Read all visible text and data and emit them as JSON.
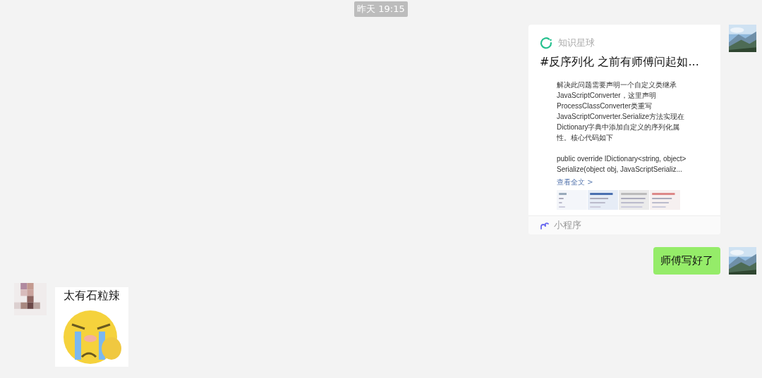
{
  "timestamp": "昨天 19:15",
  "messages": [
    {
      "kind": "card",
      "outgoing": true,
      "source": "知识星球",
      "title": "#反序列化 之前有师傅问起如...",
      "excerpt": [
        [
          "解决此问题需要声明一个自定义类继承",
          "JavaScriptConverter，这里声明",
          "ProcessClassConverter类重写",
          "JavaScriptConverter.Serialize方法实现在",
          "Dictionary字典中添加自定义的序列化属",
          "性。核心代码如下"
        ],
        [
          "public override IDictionary<string, object>",
          "Serialize(object obj, JavaScriptSerializ..."
        ]
      ],
      "more": "查看全文 >",
      "footer": "小程序"
    },
    {
      "kind": "text",
      "outgoing": true,
      "text": "师傅写好了"
    },
    {
      "kind": "sticker",
      "outgoing": false,
      "caption": "太有石粒辣"
    }
  ]
}
